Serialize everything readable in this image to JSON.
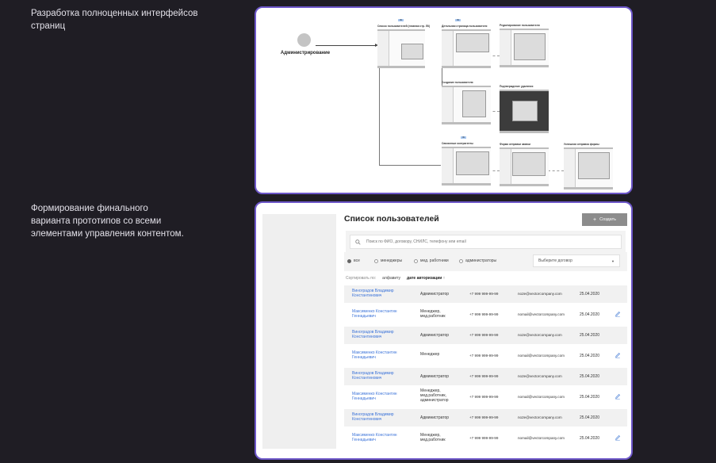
{
  "captions": {
    "top": "Разработка полноценных интерфейсов страниц",
    "bottom": "Формирование финального варианта прототипов со всеми элементами управления контентом."
  },
  "flow": {
    "root_label": "Администрирование",
    "screens": [
      {
        "title": "Список пользователей (главная стр. ЛК)"
      },
      {
        "title": "Детальная страница пользователя"
      },
      {
        "title": "Редактирование пользователя"
      },
      {
        "title": "Создание пользователя"
      },
      {
        "title": "Подтверждение удаления"
      },
      {
        "title": "Связанные контрагенты"
      },
      {
        "title": "Форма отправки заявки"
      },
      {
        "title": "Успешная отправка формы"
      }
    ]
  },
  "users": {
    "title": "Список пользователей",
    "create_label": "Создать",
    "search_placeholder": "Поиск по ФИО, договору, СНИЛС, телефону или email",
    "filters": [
      "все",
      "менеджеры",
      "мед. работники",
      "администраторы"
    ],
    "select_value": "Выберите договор",
    "sort": {
      "label": "Сортировать по:",
      "options": [
        "алфавиту",
        "дате авторизации ↑"
      ]
    },
    "rows": [
      {
        "name": "Виноградов Владимир Константинович",
        "role": "Администратор",
        "phone": "+7 999 999-99-99",
        "email": "no2e@vectorcompany.com",
        "date": "25.04.2020",
        "editable": false
      },
      {
        "name": "Максименко Константин Геннадьевич",
        "role": "Менеджер, мед.работник",
        "phone": "+7 999 999-99-99",
        "email": "nomail@vectorcompany.com",
        "date": "25.04.2020",
        "editable": true
      },
      {
        "name": "Виноградов Владимир Константинович",
        "role": "Администратор",
        "phone": "+7 999 999-99-99",
        "email": "no2e@vectorcompany.com",
        "date": "25.04.2020",
        "editable": false
      },
      {
        "name": "Максименко Константин Геннадьевич",
        "role": "Менеджер",
        "phone": "+7 999 999-99-99",
        "email": "nomail@vectorcompany.com",
        "date": "25.04.2020",
        "editable": true
      },
      {
        "name": "Виноградов Владимир Константинович",
        "role": "Администратор",
        "phone": "+7 999 999-99-99",
        "email": "no2e@vectorcompany.com",
        "date": "25.04.2020",
        "editable": false
      },
      {
        "name": "Максименко Константин Геннадьевич",
        "role": "Менеджер, мед.работник, администратор",
        "phone": "+7 999 999-99-99",
        "email": "nomail@vectorcompany.com",
        "date": "25.04.2020",
        "editable": true
      },
      {
        "name": "Виноградов Владимир Константинович",
        "role": "Администратор",
        "phone": "+7 999 999-99-99",
        "email": "no2e@vectorcompany.com",
        "date": "25.04.2020",
        "editable": false
      },
      {
        "name": "Максименко Константин Геннадьевич",
        "role": "Менеджер, мед.работник",
        "phone": "+7 999 999-99-99",
        "email": "nomail@vectorcompany.com",
        "date": "25.04.2020",
        "editable": true
      }
    ]
  }
}
